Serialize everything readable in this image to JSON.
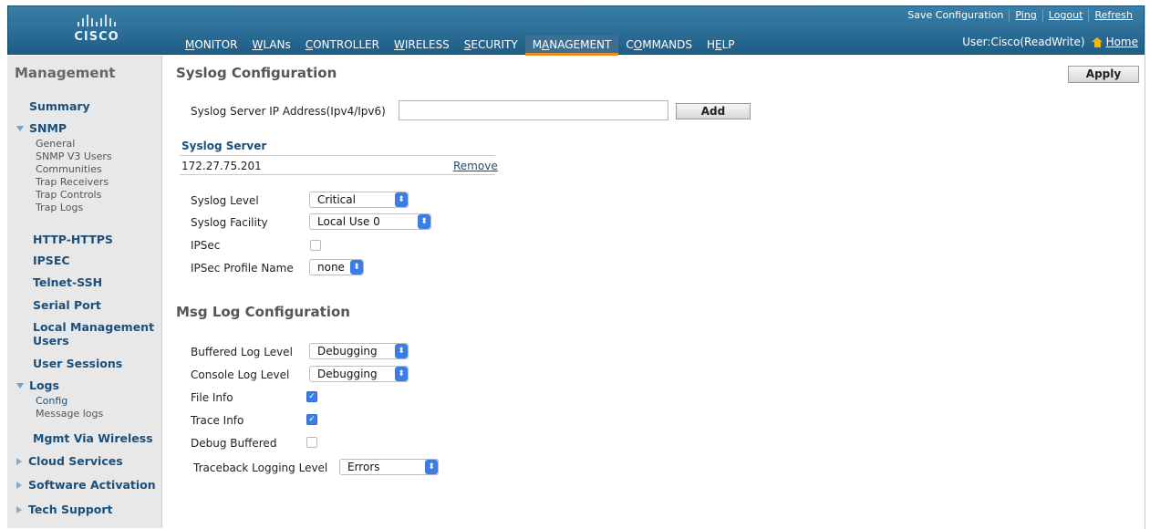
{
  "brand": {
    "logo_text": "CISCO"
  },
  "top_links": [
    "Save Configuration",
    "Ping",
    "Logout",
    "Refresh"
  ],
  "top_nav": [
    {
      "label": "MONITOR",
      "u": "M",
      "rest": "ONITOR"
    },
    {
      "label": "WLANs",
      "u": "W",
      "rest": "LANs"
    },
    {
      "label": "CONTROLLER",
      "u": "C",
      "rest": "ONTROLLER"
    },
    {
      "label": "WIRELESS",
      "u": "W",
      "rest": "IRELESS"
    },
    {
      "label": "SECURITY",
      "u": "S",
      "rest": "ECURITY"
    },
    {
      "label": "MANAGEMENT",
      "u": "A",
      "pre": "M",
      "rest": "NAGEMENT"
    },
    {
      "label": "COMMANDS",
      "u": "O",
      "pre": "C",
      "rest": "MMANDS"
    },
    {
      "label": "HELP",
      "u": "E",
      "pre": "H",
      "rest": "LP"
    }
  ],
  "user": {
    "label": "User:Cisco(ReadWrite)",
    "home": "Home"
  },
  "sidebar": {
    "title": "Management",
    "items": {
      "summary": "Summary",
      "snmp": "SNMP",
      "snmp_sub": [
        "General",
        "SNMP V3 Users",
        "Communities",
        "Trap Receivers",
        "Trap Controls",
        "Trap Logs"
      ],
      "http": "HTTP-HTTPS",
      "ipsec": "IPSEC",
      "telnet": "Telnet-SSH",
      "serial": "Serial Port",
      "local_mgmt_1": "Local Management",
      "local_mgmt_2": "Users",
      "user_sessions": "User Sessions",
      "logs": "Logs",
      "logs_sub": [
        "Config",
        "Message logs"
      ],
      "mgmt_wireless": "Mgmt Via Wireless",
      "cloud": "Cloud Services",
      "software": "Software Activation",
      "tech": "Tech Support"
    }
  },
  "main": {
    "title": "Syslog Configuration",
    "apply": "Apply",
    "server_ip_label": "Syslog Server IP Address(Ipv4/Ipv6)",
    "server_ip_value": "",
    "add": "Add",
    "server_header": "Syslog Server",
    "server_entry": "172.27.75.201",
    "remove": "Remove",
    "syslog_level_label": "Syslog Level",
    "syslog_level": "Critical",
    "syslog_facility_label": "Syslog Facility",
    "syslog_facility": "Local Use 0",
    "ipsec_label": "IPSec",
    "ipsec_checked": false,
    "ipsec_profile_label": "IPSec Profile Name",
    "ipsec_profile": "none",
    "msg_title": "Msg Log Configuration",
    "buffered_label": "Buffered Log Level",
    "buffered": "Debugging",
    "console_label": "Console Log Level",
    "console": "Debugging",
    "file_info_label": "File Info",
    "file_info_checked": true,
    "trace_info_label": "Trace Info",
    "trace_info_checked": true,
    "debug_buffered_label": "Debug Buffered",
    "debug_buffered_checked": false,
    "traceback_label": "Traceback Logging Level",
    "traceback": "Errors"
  },
  "colors": {
    "header": "#2a6a93",
    "accent": "#f08a1c",
    "link": "#1b4f7a",
    "select_arrow": "#3b7de6"
  }
}
